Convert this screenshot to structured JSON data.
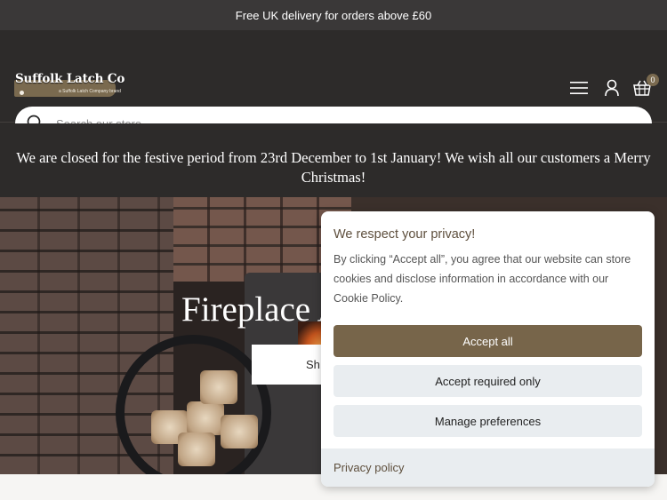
{
  "announcement": {
    "text": "Free UK delivery for orders above £60"
  },
  "header": {
    "logo": {
      "title": "Suffolk Latch Co",
      "tagline": "a Suffolk Latch Company brand"
    },
    "cart": {
      "count": "0"
    },
    "search": {
      "placeholder": "Search our store"
    }
  },
  "notice": {
    "text": "We are closed for the festive period from 23rd December to 1st January! We wish all our customers a Merry Christmas!"
  },
  "hero": {
    "title": "Fireplace A",
    "button_label": "Sh"
  },
  "cookie_banner": {
    "title": "We respect your privacy!",
    "text": "By clicking “Accept all”, you agree that our website can store cookies and disclose information in accordance with our Cookie Policy.",
    "accept_all": "Accept all",
    "accept_required": "Accept required only",
    "manage": "Manage preferences",
    "privacy_link": "Privacy policy"
  },
  "colors": {
    "header_bg": "#2d2b2a",
    "accent": "#77654a",
    "secondary_button": "#e9edf0"
  },
  "icons": [
    "search-icon",
    "menu-icon",
    "account-icon",
    "cart-icon"
  ]
}
